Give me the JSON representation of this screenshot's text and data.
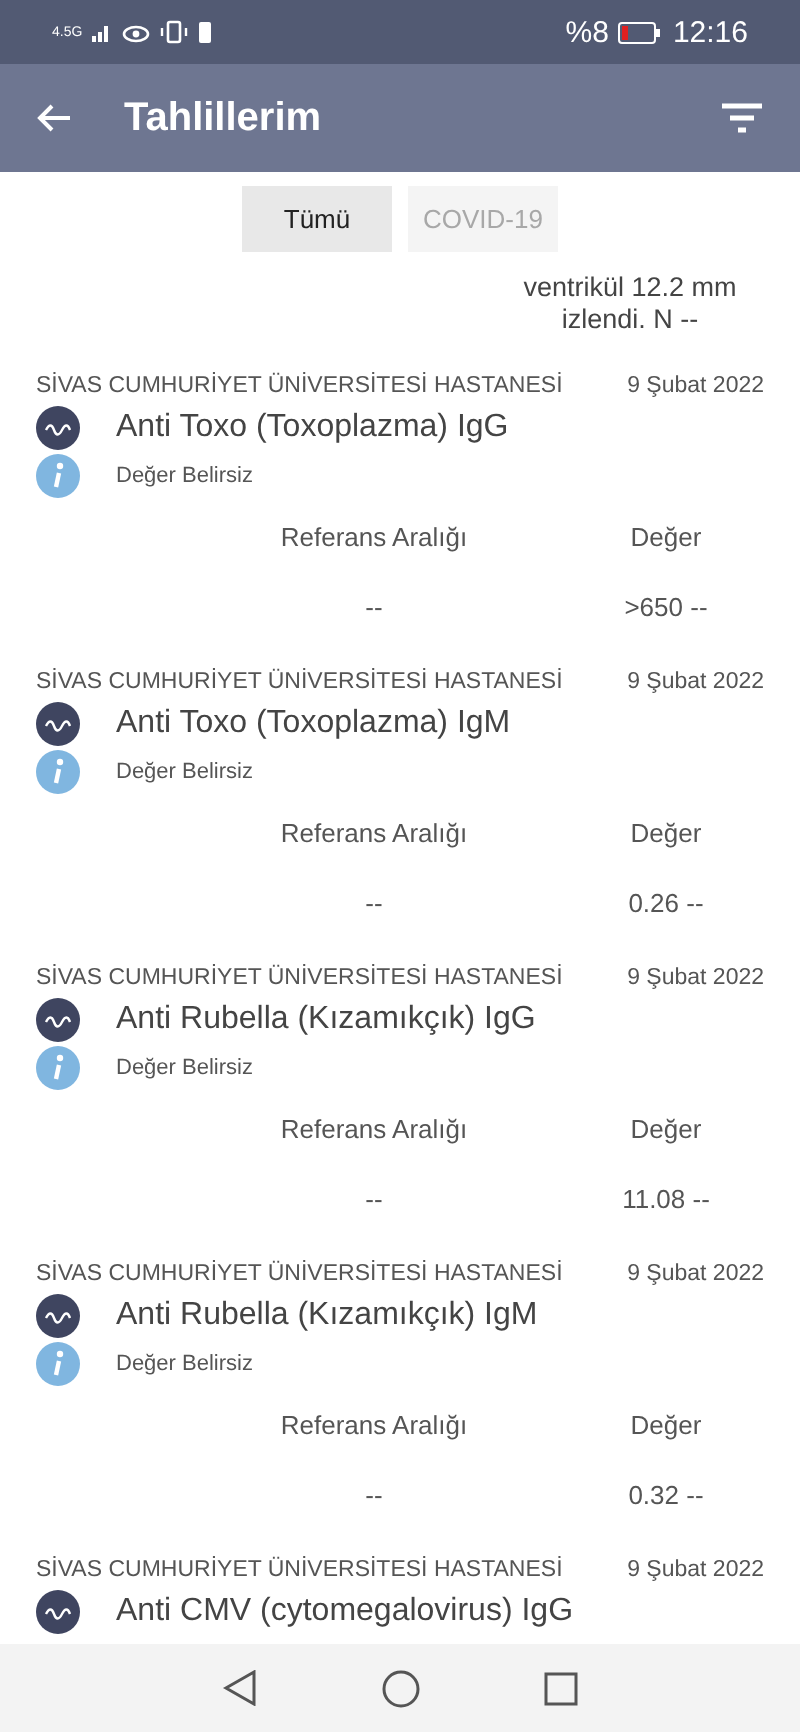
{
  "status_bar": {
    "network": "4.5G",
    "battery": "%8",
    "time": "12:16"
  },
  "app_bar": {
    "title": "Tahlillerim"
  },
  "filters": [
    {
      "label": "Tümü",
      "selected": true
    },
    {
      "label": "COVID-19",
      "selected": false
    }
  ],
  "note": [
    "ventrikül 12.2 mm",
    "izlendi. N --"
  ],
  "results": [
    {
      "hospital": "SİVAS CUMHURİYET ÜNİVERSİTESİ HASTANESİ",
      "date": "9 Şubat 2022",
      "test": "Anti Toxo (Toxoplazma) IgG",
      "status": "Değer Belirsiz",
      "reference_header": "Referans Aralığı",
      "value_header": "Değer",
      "reference": "--",
      "value": ">650 --"
    },
    {
      "hospital": "SİVAS CUMHURİYET ÜNİVERSİTESİ HASTANESİ",
      "date": "9 Şubat 2022",
      "test": "Anti Toxo (Toxoplazma) IgM",
      "status": "Değer Belirsiz",
      "reference_header": "Referans Aralığı",
      "value_header": "Değer",
      "reference": "--",
      "value": "0.26 --"
    },
    {
      "hospital": "SİVAS CUMHURİYET ÜNİVERSİTESİ HASTANESİ",
      "date": "9 Şubat 2022",
      "test": "Anti Rubella (Kızamıkçık) IgG",
      "status": "Değer Belirsiz",
      "reference_header": "Referans Aralığı",
      "value_header": "Değer",
      "reference": "--",
      "value": "11.08 --"
    },
    {
      "hospital": "SİVAS CUMHURİYET ÜNİVERSİTESİ HASTANESİ",
      "date": "9 Şubat 2022",
      "test": "Anti Rubella (Kızamıkçık) IgM",
      "status": "Değer Belirsiz",
      "reference_header": "Referans Aralığı",
      "value_header": "Değer",
      "reference": "--",
      "value": "0.32 --"
    },
    {
      "hospital": "SİVAS CUMHURİYET ÜNİVERSİTESİ HASTANESİ",
      "date": "9 Şubat 2022",
      "test": "Anti CMV (cytomegalovirus) IgG"
    }
  ]
}
